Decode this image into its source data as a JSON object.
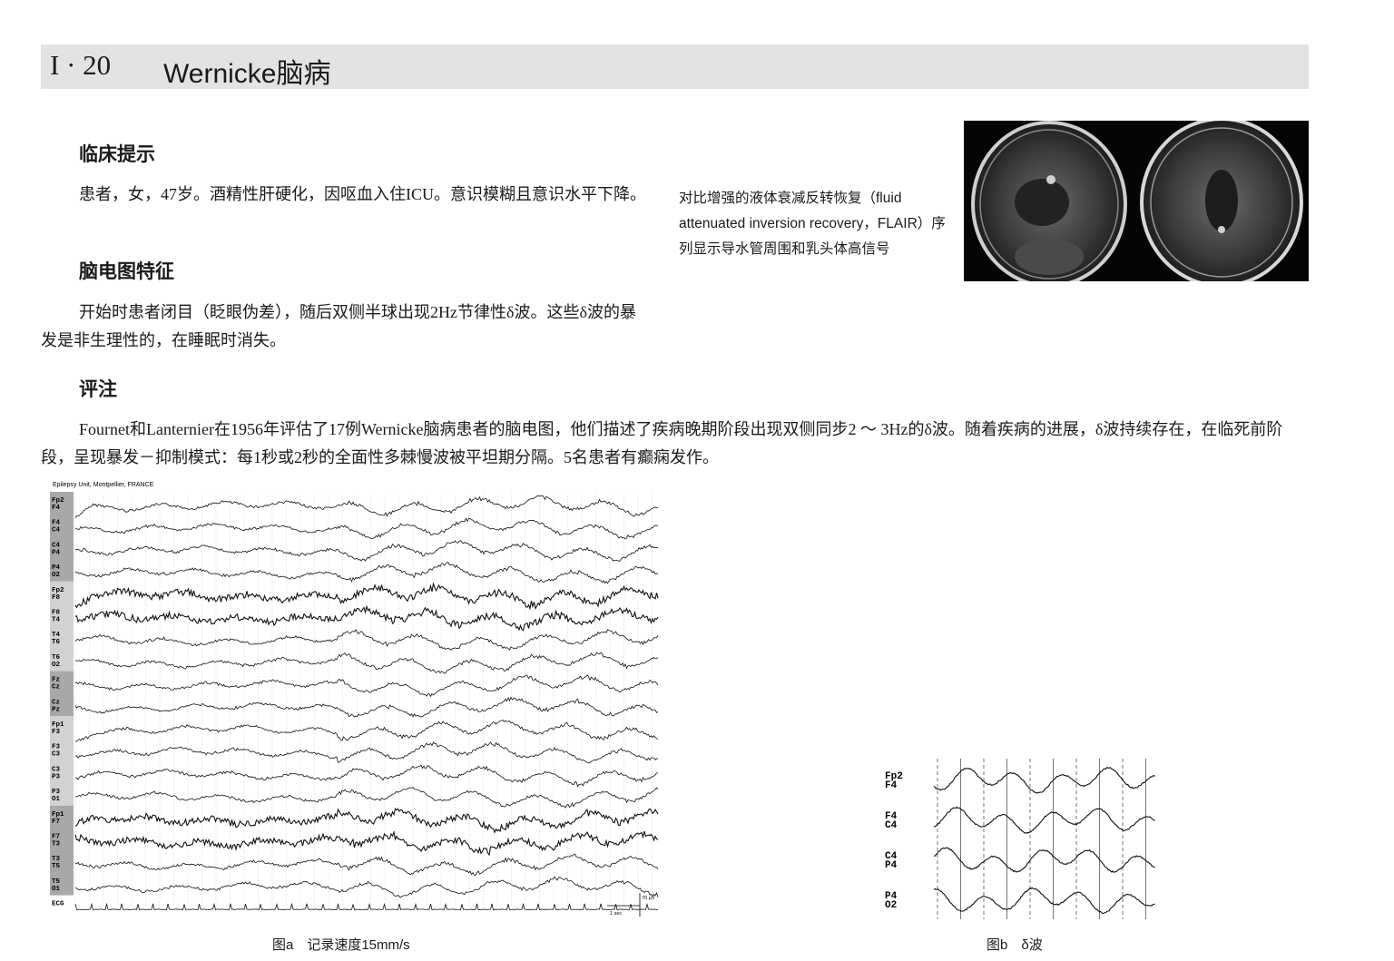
{
  "header": {
    "number": "I · 20",
    "title": "Wernicke脑病"
  },
  "sections": {
    "clinical": {
      "heading": "临床提示",
      "text": "患者，女，47岁。酒精性肝硬化，因呕血入住ICU。意识模糊且意识水平下降。"
    },
    "eeg_features": {
      "heading": "脑电图特征",
      "text": "开始时患者闭目（眨眼伪差），随后双侧半球出现2Hz节律性δ波。这些δ波的暴发是非生理性的，在睡眠时消失。"
    },
    "comments": {
      "heading": "评注",
      "text": "Fournet和Lanternier在1956年评估了17例Wernicke脑病患者的脑电图，他们描述了疾病晚期阶段出现双侧同步2 ～ 3Hz的δ波。随着疾病的进展，δ波持续存在，在临死前阶段，呈现暴发－抑制模式：每1秒或2秒的全面性多棘慢波被平坦期分隔。5名患者有癫痫发作。"
    }
  },
  "mri_caption": "对比增强的液体衰减反转恢复（fluid attenuated inversion recovery，FLAIR）序列显示导水管周围和乳头体高信号",
  "figure_a": {
    "source_label": "Epilepsy Unit, Montpellier, FRANCE",
    "channels": [
      [
        "Fp2",
        "F4"
      ],
      [
        "F4",
        "C4"
      ],
      [
        "C4",
        "P4"
      ],
      [
        "P4",
        "O2"
      ],
      [
        "Fp2",
        "F8"
      ],
      [
        "F8",
        "T4"
      ],
      [
        "T4",
        "T6"
      ],
      [
        "T6",
        "O2"
      ],
      [
        "Fz",
        "Cz"
      ],
      [
        "Cz",
        "Pz"
      ],
      [
        "Fp1",
        "F3"
      ],
      [
        "F3",
        "C3"
      ],
      [
        "C3",
        "P3"
      ],
      [
        "P3",
        "O1"
      ],
      [
        "Fp1",
        "F7"
      ],
      [
        "F7",
        "T3"
      ],
      [
        "T3",
        "T5"
      ],
      [
        "T5",
        "O1"
      ],
      [
        "ECG"
      ]
    ],
    "amplitude_scale": "70 µV",
    "time_scale": "1 sec",
    "caption": "图a　记录速度15mm/s"
  },
  "figure_b": {
    "channels": [
      [
        "Fp2",
        "F4"
      ],
      [
        "F4",
        "C4"
      ],
      [
        "C4",
        "P4"
      ],
      [
        "P4",
        "O2"
      ]
    ],
    "caption": "图b　δ波"
  }
}
